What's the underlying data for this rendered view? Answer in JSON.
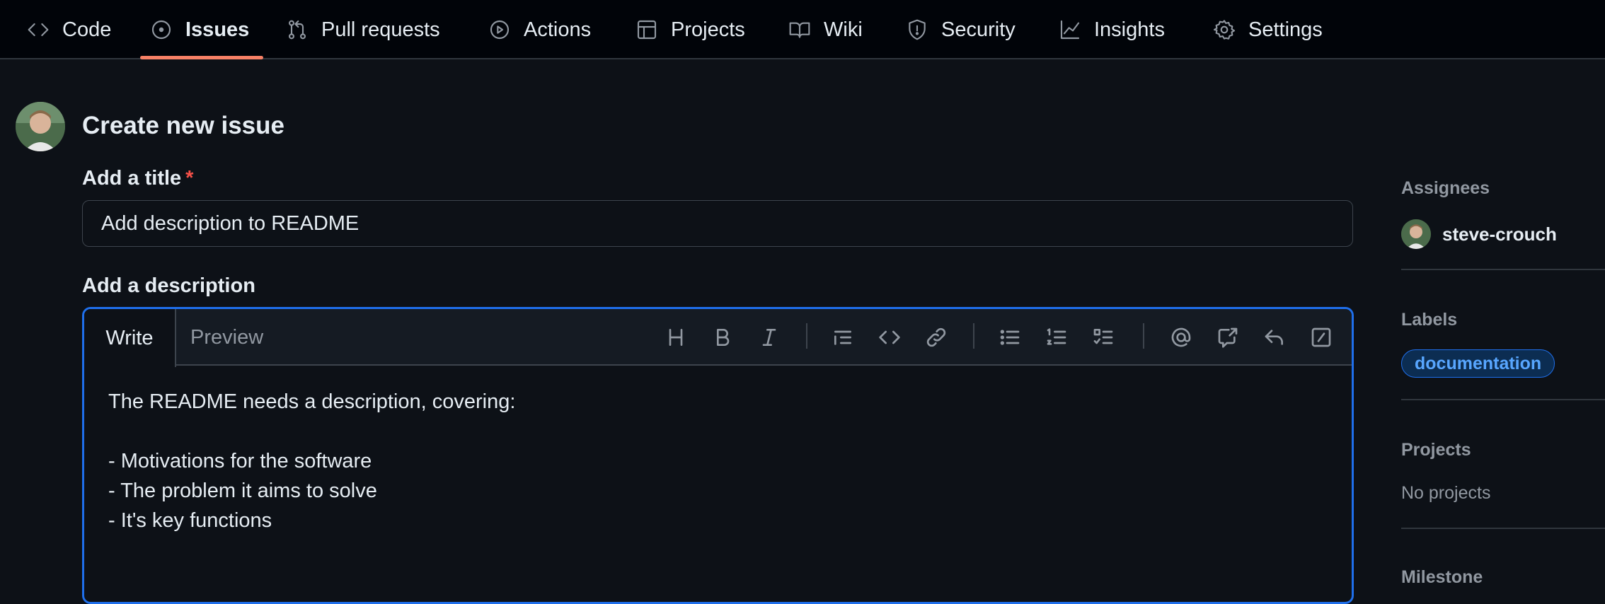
{
  "nav": {
    "items": [
      {
        "label": "Code",
        "icon": "code-icon"
      },
      {
        "label": "Issues",
        "icon": "issue-opened-icon",
        "active": true
      },
      {
        "label": "Pull requests",
        "icon": "git-pull-request-icon"
      },
      {
        "label": "Actions",
        "icon": "play-icon"
      },
      {
        "label": "Projects",
        "icon": "table-icon"
      },
      {
        "label": "Wiki",
        "icon": "book-icon"
      },
      {
        "label": "Security",
        "icon": "shield-icon"
      },
      {
        "label": "Insights",
        "icon": "graph-icon"
      },
      {
        "label": "Settings",
        "icon": "gear-icon"
      }
    ],
    "active_color": "#f78166"
  },
  "page": {
    "title": "Create new issue"
  },
  "form": {
    "title_label": "Add a title",
    "required_mark": "*",
    "title_value": "Add description to README",
    "description_label": "Add a description",
    "tabs": {
      "write": "Write",
      "preview": "Preview"
    },
    "toolbar_icons": [
      "heading-icon",
      "bold-icon",
      "italic-icon",
      "quote-icon",
      "code-icon",
      "link-icon",
      "unordered-list-icon",
      "ordered-list-icon",
      "tasklist-icon",
      "mention-icon",
      "cross-reference-icon",
      "reply-icon",
      "slash-command-icon"
    ],
    "body_lines": [
      "The README needs a description, covering:",
      "",
      "- Motivations for the software",
      "- The problem it aims to solve",
      "- It's key functions"
    ],
    "focus_color": "#1f6feb"
  },
  "sidebar": {
    "assignees_label": "Assignees",
    "assignee_name": "steve-crouch",
    "labels_label": "Labels",
    "label_name": "documentation",
    "projects_label": "Projects",
    "projects_value": "No projects",
    "milestone_label": "Milestone"
  }
}
